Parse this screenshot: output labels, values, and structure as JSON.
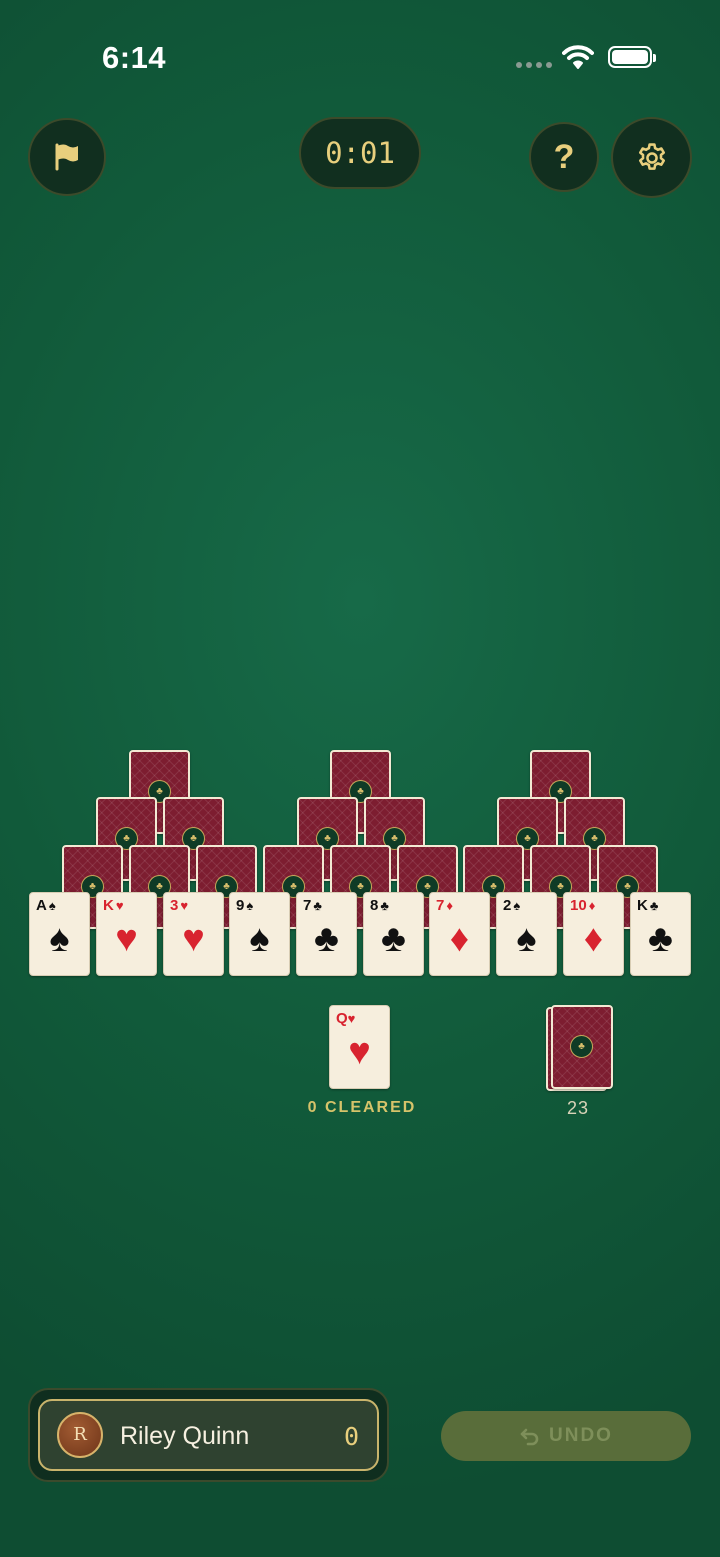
{
  "status_bar": {
    "time": "6:14"
  },
  "toolbar": {
    "timer": "0:01",
    "help_label": "?"
  },
  "tableau": {
    "row4": [
      {
        "rank": "A",
        "suit": "♠",
        "color": "black"
      },
      {
        "rank": "K",
        "suit": "♥",
        "color": "red"
      },
      {
        "rank": "3",
        "suit": "♥",
        "color": "red"
      },
      {
        "rank": "9",
        "suit": "♠",
        "color": "black"
      },
      {
        "rank": "7",
        "suit": "♣",
        "color": "black"
      },
      {
        "rank": "8",
        "suit": "♣",
        "color": "black"
      },
      {
        "rank": "7",
        "suit": "♦",
        "color": "red"
      },
      {
        "rank": "2",
        "suit": "♠",
        "color": "black"
      },
      {
        "rank": "10",
        "suit": "♦",
        "color": "red"
      },
      {
        "rank": "K",
        "suit": "♣",
        "color": "black"
      }
    ]
  },
  "waste": {
    "rank": "Q",
    "suit": "♥",
    "color": "red"
  },
  "cleared_label": "0 CLEARED",
  "stock": {
    "count": "23"
  },
  "player": {
    "initial": "R",
    "name": "Riley Quinn",
    "score": "0"
  },
  "undo_label": "UNDO",
  "colors": {
    "felt": "#135f3f",
    "gold": "#e8cf7d",
    "card_back": "#7d1d30",
    "card_face": "#f6eedd"
  }
}
